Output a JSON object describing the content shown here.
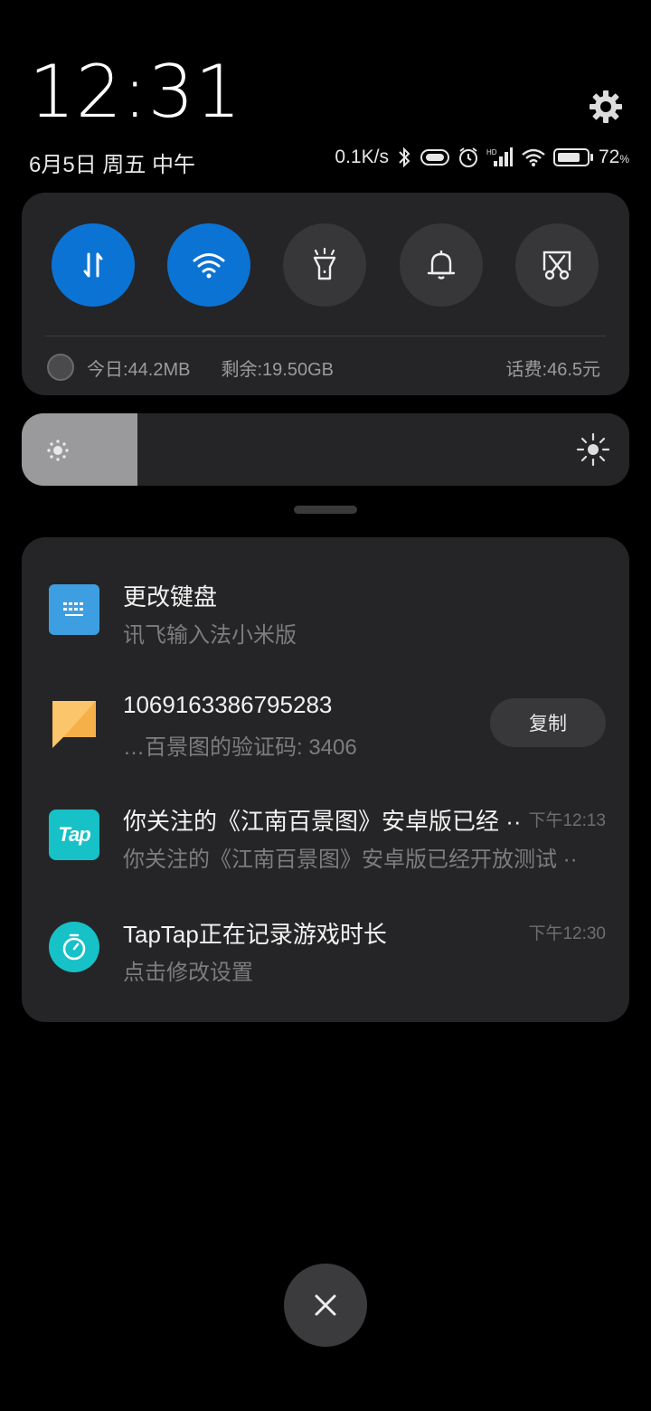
{
  "header": {
    "time": "12:31",
    "date": "6月5日 周五 中午",
    "net_speed": "0.1K/s",
    "battery": "72",
    "battery_unit": "%",
    "signal_label": "HD"
  },
  "quick_settings": {
    "tiles": [
      {
        "name": "mobile-data",
        "icon": "data-arrows-icon",
        "active": true
      },
      {
        "name": "wifi",
        "icon": "wifi-icon",
        "active": true
      },
      {
        "name": "flashlight",
        "icon": "flashlight-icon",
        "active": false
      },
      {
        "name": "sound",
        "icon": "bell-icon",
        "active": false
      },
      {
        "name": "screenshot",
        "icon": "scissors-icon",
        "active": false
      }
    ],
    "usage_today": "今日:44.2MB",
    "remaining": "剩余:19.50GB",
    "balance": "话费:46.5元"
  },
  "brightness": {
    "level": 0.19
  },
  "notifications": [
    {
      "title": "更改键盘",
      "subtitle": "讯飞输入法小米版",
      "time": "",
      "icon": "keyboard-icon"
    },
    {
      "title": "1069163386795283",
      "subtitle": "…百景图的验证码: 3406",
      "time": "",
      "icon": "message-icon",
      "action": "复制"
    },
    {
      "title": "你关注的《江南百景图》安卓版已经 ··",
      "subtitle": "你关注的《江南百景图》安卓版已经开放测试 ··",
      "time": "下午12:13",
      "icon": "taptap-icon",
      "icon_text": "Tap"
    },
    {
      "title": "TapTap正在记录游戏时长",
      "subtitle": "点击修改设置",
      "time": "下午12:30",
      "icon": "timer-icon"
    }
  ],
  "colors": {
    "accent": "#0b73d4",
    "panel": "#252527",
    "background": "#000000"
  }
}
